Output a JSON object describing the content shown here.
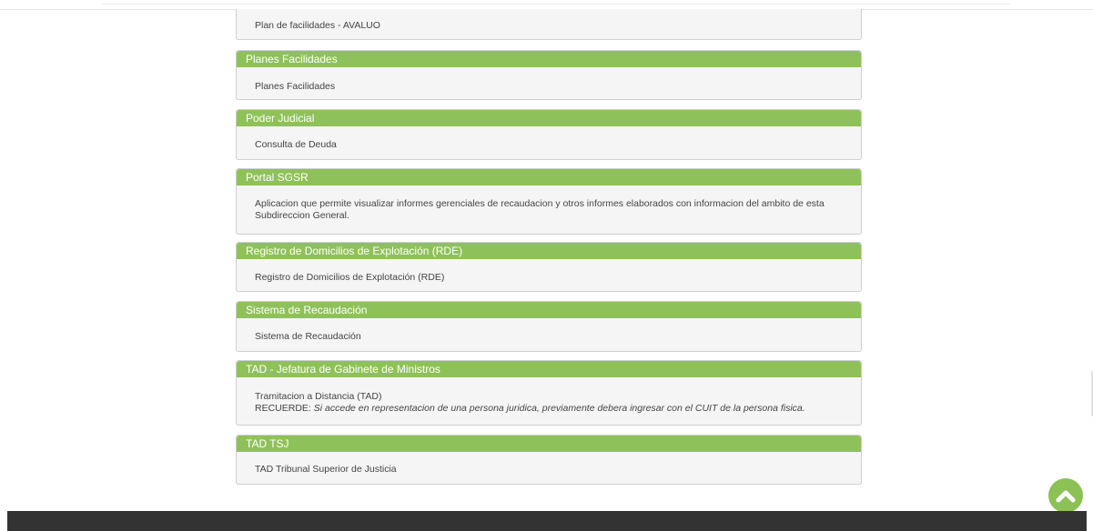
{
  "panels": [
    {
      "title": "",
      "body": "Plan de facilidades - AVALUO"
    },
    {
      "title": "Planes Facilidades",
      "body": "Planes Facilidades"
    },
    {
      "title": "Poder Judicial",
      "body": "Consulta de Deuda"
    },
    {
      "title": "Portal SGSR",
      "body": "Aplicacion que permite visualizar informes gerenciales de recaudacion y otros informes elaborados con informacion del ambito de esta Subdireccion General."
    },
    {
      "title": "Registro de Domicilios de Explotación (RDE)",
      "body": "Registro de Domicilios de Explotación (RDE)"
    },
    {
      "title": "Sistema de Recaudación",
      "body": "Sistema de Recaudación"
    },
    {
      "title": "TAD - Jefatura de Gabinete de Ministros",
      "body": "Tramitacion a Distancia (TAD)",
      "note_label": "RECUERDE:",
      "note_text": "Si accede en representacion de una persona juridica, previamente debera ingresar con el CUIT de la persona fisica."
    },
    {
      "title": "TAD TSJ",
      "body": "TAD Tribunal Superior de Justicia"
    }
  ],
  "colors": {
    "header_green": "#8fc15a",
    "panel_bg": "#f5f5f5",
    "footer": "#333333"
  },
  "scroll_top": {
    "icon": "chevron-up-icon"
  }
}
